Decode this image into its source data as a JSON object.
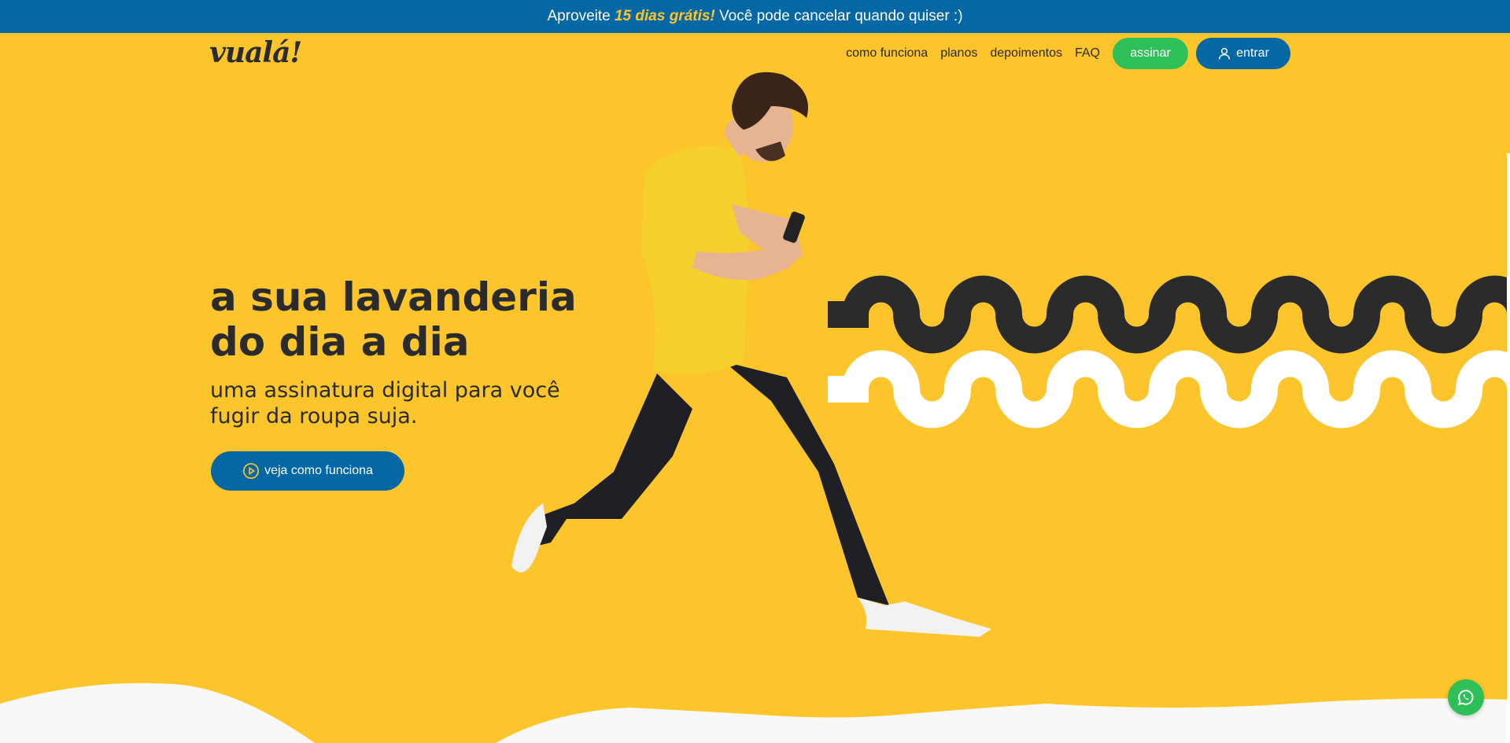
{
  "promo_bar": {
    "prefix": "Aproveite ",
    "highlight": "15 dias grátis!",
    "suffix": " Você pode cancelar quando quiser :)"
  },
  "header": {
    "logo": "vualá!",
    "nav": [
      {
        "label": "como funciona"
      },
      {
        "label": "planos"
      },
      {
        "label": "depoimentos"
      },
      {
        "label": "FAQ"
      }
    ],
    "subscribe_label": "assinar",
    "login_label": "entrar"
  },
  "hero": {
    "title_line1": "a sua lavanderia",
    "title_line2": "do dia a dia",
    "subtitle_line1": "uma assinatura digital para você",
    "subtitle_line2": "fugir da roupa suja.",
    "video_button_label": "veja como funciona"
  },
  "colors": {
    "background": "#fdc52c",
    "primary_blue": "#0567a4",
    "green": "#2fbf58",
    "dark": "#2b2b2b",
    "white": "#ffffff"
  },
  "icons": {
    "login": "user-icon",
    "video": "play-circle-icon",
    "chat": "whatsapp-icon"
  }
}
